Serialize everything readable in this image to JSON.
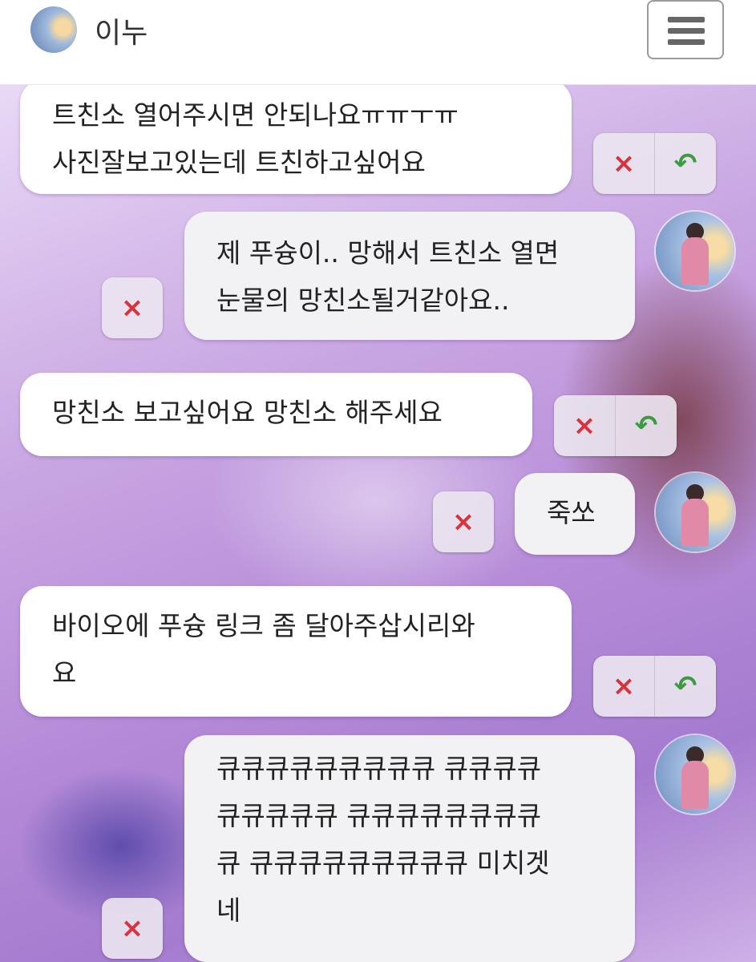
{
  "header": {
    "contact_name": "이누"
  },
  "icons": {
    "delete": "×",
    "reply": "↶",
    "menu": "hamburger-icon"
  },
  "colors": {
    "delete": "#d8323a",
    "reply": "#3b9a42"
  },
  "messages": [
    {
      "sender": "contact",
      "text": "트친소 열어주시면 안되나요ㅠㅠㅜㅠ\n사진잘보고있는데 트친하고싶어요"
    },
    {
      "sender": "me",
      "text": "제 푸슝이.. 망해서 트친소 열면\n눈물의 망친소될거같아요.."
    },
    {
      "sender": "contact",
      "text": "망친소 보고싶어요 망친소 해주세요"
    },
    {
      "sender": "me",
      "text": "죽쏘"
    },
    {
      "sender": "contact",
      "text": "바이오에 푸슝 링크 좀 달아주삽시리와\n요"
    },
    {
      "sender": "me",
      "text": "큐큐큐큐큐큐큐큐큐 큐큐큐큐\n큐큐큐큐큐 큐큐큐큐큐큐큐큐\n큐 큐큐큐큐큐큐큐큐큐 미치겟\n네"
    }
  ]
}
